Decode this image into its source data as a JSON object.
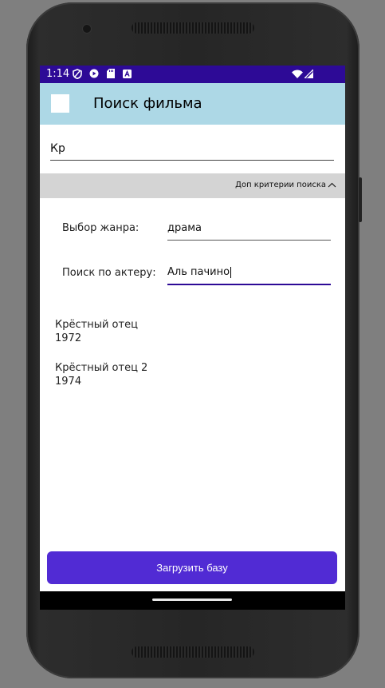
{
  "status_bar": {
    "time": "1:14",
    "icons": [
      "shield-icon",
      "play-icon",
      "sd-card-icon",
      "a-icon",
      "wifi-icon",
      "signal-icon"
    ]
  },
  "app_bar": {
    "title": "Поиск фильма",
    "color": "#add8e6"
  },
  "search": {
    "value": "Кр"
  },
  "expander": {
    "label": "Доп критерии поиска",
    "icon": "chevron-up-icon"
  },
  "filters": {
    "genre_label": "Выбор жанра:",
    "genre_value": "драма",
    "actor_label": "Поиск по актеру:",
    "actor_value": "Аль пачино"
  },
  "results": [
    {
      "title": "Крёстный отец",
      "year": "1972"
    },
    {
      "title": "Крёстный отец 2",
      "year": "1974"
    }
  ],
  "load_button": {
    "label": "Загрузить базу",
    "color": "#512bd4"
  },
  "colors": {
    "status_bar": "#2d0a96",
    "accent": "#512bd4",
    "expander_bg": "#d4d4d4"
  }
}
